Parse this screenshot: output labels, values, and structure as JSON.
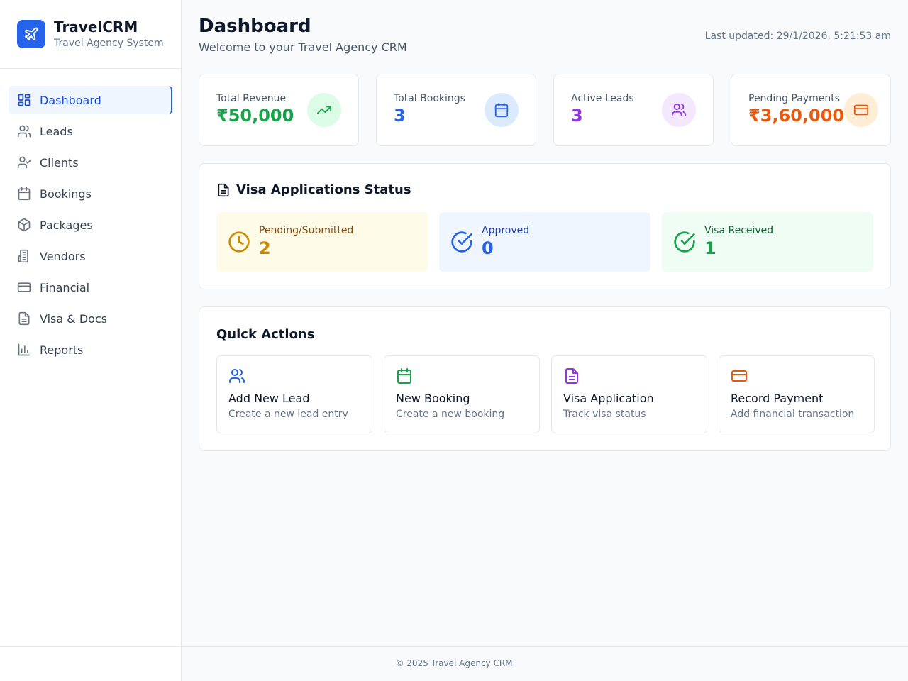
{
  "brand": {
    "title": "TravelCRM",
    "subtitle": "Travel Agency System",
    "icon": "plane-icon",
    "color": "#2563eb"
  },
  "sidebar": {
    "items": [
      {
        "label": "Dashboard",
        "icon": "dashboard-icon",
        "active": true
      },
      {
        "label": "Leads",
        "icon": "users-icon"
      },
      {
        "label": "Clients",
        "icon": "user-check-icon"
      },
      {
        "label": "Bookings",
        "icon": "calendar-icon"
      },
      {
        "label": "Packages",
        "icon": "package-icon"
      },
      {
        "label": "Vendors",
        "icon": "building-icon"
      },
      {
        "label": "Financial",
        "icon": "credit-card-icon"
      },
      {
        "label": "Visa & Docs",
        "icon": "file-text-icon"
      },
      {
        "label": "Reports",
        "icon": "bar-chart-icon"
      }
    ]
  },
  "header": {
    "title": "Dashboard",
    "subtitle": "Welcome to your Travel Agency CRM",
    "updated": "Last updated: 29/1/2026, 5:21:53 am"
  },
  "stats": [
    {
      "label": "Total Revenue",
      "value": "₹50,000",
      "color": "#16a34a",
      "icon": "trending-up-icon"
    },
    {
      "label": "Total Bookings",
      "value": "3",
      "color": "#2563eb",
      "icon": "calendar-icon"
    },
    {
      "label": "Active Leads",
      "value": "3",
      "color": "#9333ea",
      "icon": "users-icon"
    },
    {
      "label": "Pending Payments",
      "value": "₹3,60,000",
      "color": "#ea580c",
      "icon": "credit-card-icon"
    }
  ],
  "visa": {
    "title": "Visa Applications Status",
    "boxes": [
      {
        "label": "Pending/Submitted",
        "value": "2",
        "icon": "clock-icon"
      },
      {
        "label": "Approved",
        "value": "0",
        "icon": "check-circle-icon"
      },
      {
        "label": "Visa Received",
        "value": "1",
        "icon": "check-circle-icon"
      }
    ]
  },
  "quick_actions": {
    "title": "Quick Actions",
    "items": [
      {
        "name": "Add New Lead",
        "desc": "Create a new lead entry",
        "icon": "users-icon"
      },
      {
        "name": "New Booking",
        "desc": "Create a new booking",
        "icon": "calendar-icon"
      },
      {
        "name": "Visa Application",
        "desc": "Track visa status",
        "icon": "file-text-icon"
      },
      {
        "name": "Record Payment",
        "desc": "Add financial transaction",
        "icon": "credit-card-icon"
      }
    ]
  },
  "footer": {
    "text": "© 2025 Travel Agency CRM"
  }
}
